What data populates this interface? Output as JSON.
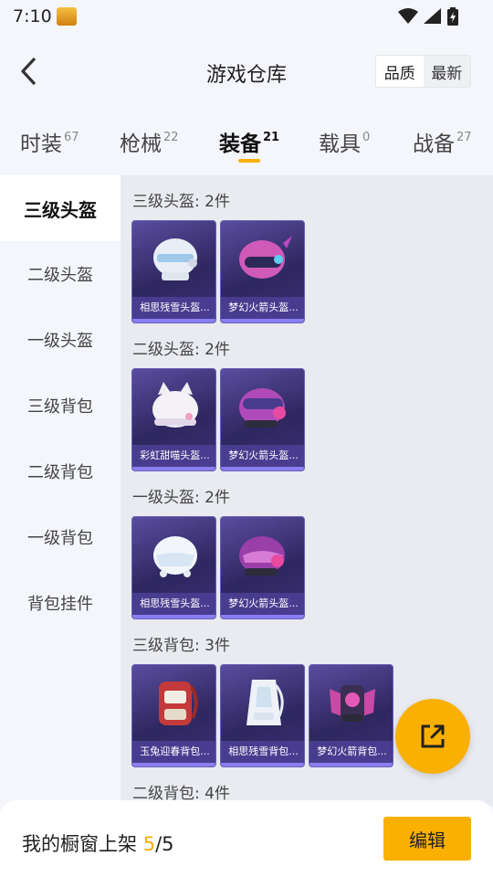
{
  "status_bar": {
    "time": "7:10"
  },
  "header": {
    "title": "游戏仓库",
    "sort": [
      "品质",
      "最新"
    ]
  },
  "tabs": [
    {
      "label": "时装",
      "count": "67"
    },
    {
      "label": "枪械",
      "count": "22"
    },
    {
      "label": "装备",
      "count": "21",
      "active": true
    },
    {
      "label": "载具",
      "count": "0"
    },
    {
      "label": "战备",
      "count": "27"
    }
  ],
  "sidebar": [
    {
      "label": "三级头盔",
      "active": true
    },
    {
      "label": "二级头盔"
    },
    {
      "label": "一级头盔"
    },
    {
      "label": "三级背包"
    },
    {
      "label": "二级背包"
    },
    {
      "label": "一级背包"
    },
    {
      "label": "背包挂件"
    }
  ],
  "groups": [
    {
      "title": "三级头盔: 2件",
      "items": [
        "相思残雪头盔...",
        "梦幻火箭头盔..."
      ]
    },
    {
      "title": "二级头盔: 2件",
      "items": [
        "彩虹甜喵头盔...",
        "梦幻火箭头盔..."
      ]
    },
    {
      "title": "一级头盔: 2件",
      "items": [
        "相思残雪头盔...",
        "梦幻火箭头盔..."
      ]
    },
    {
      "title": "三级背包: 3件",
      "items": [
        "玉兔迎春背包...",
        "相思残雪背包...",
        "梦幻火箭背包..."
      ]
    },
    {
      "title": "二级背包: 4件",
      "items": []
    }
  ],
  "bottom": {
    "label": "我的橱窗上架",
    "current": "5",
    "separator": "/",
    "total": "5",
    "edit_label": "编辑"
  },
  "icons": {
    "back": "chevron-left-icon",
    "share": "share-icon",
    "wifi": "wifi-icon",
    "signal": "signal-icon",
    "battery": "battery-icon"
  },
  "colors": {
    "accent": "#f9b000",
    "card": "#3a2f74"
  }
}
